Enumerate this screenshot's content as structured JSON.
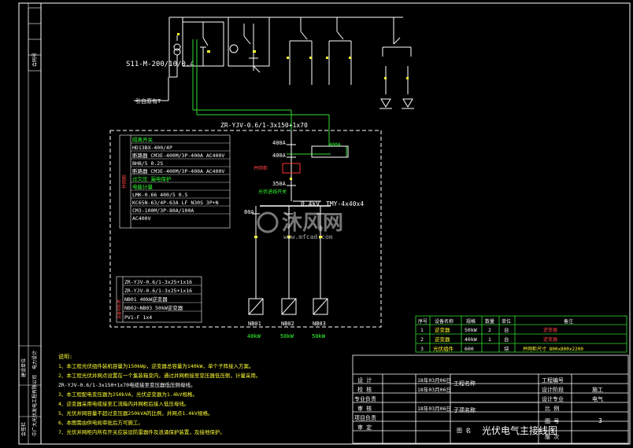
{
  "top": {
    "transformer_label": "S11-M-200/10/0.4",
    "incoming_label": "引自原有T"
  },
  "cable_top": "ZR-YJV-0.6/1-3x150+1x70",
  "breakers": {
    "b400a_1": "400A",
    "b400a_2": "400A",
    "b350a": "350A",
    "b80a": "80A",
    "b400a_note": "400A"
  },
  "box_label_1": "并网柜",
  "red_note": "并网柜",
  "switch_note": "光伏进线开关",
  "bus_label": "0.4kV",
  "bus_spec": "TMY-4x40x4",
  "legend_items": [
    "隔离开关",
    "HD13BX-400/4P",
    "断路器 CM3E-400M/3P-400A AC400V",
    "BHB/5 0.2S",
    "断路器 CM3E-400M/3P-400A AC400V",
    "过欠压 漏电保护",
    "电能计量",
    "LMK-0.66 400/5 0.5",
    "KC65N-63/4P-63A LF N30S 3P+N",
    "CM3-100M/3P-80A/100A",
    "AC400V"
  ],
  "side_label": "设备材料表",
  "cable_items": [
    "ZR-YJV-0.6/1-3x25+1x16",
    "ZR-YJV-0.6/1-3x25+1x16",
    "NB01 40kW逆变器",
    "NB02~NB03 50kW逆变器",
    "PV1-F 1x4"
  ],
  "inverters": [
    {
      "label": "NB01",
      "power": "40kW"
    },
    {
      "label": "NB02",
      "power": "50kW"
    },
    {
      "label": "NB03",
      "power": "50kW"
    }
  ],
  "notes": [
    "说明:",
    "1、本工程光伏组件装机容量为150kWp，逆变器总容量为140kW，单个子阵接入方案。",
    "2、本工程光伏并网点设置在一个集装箱变内，通过并网柜接至变压器低压侧，计量采用。",
    "ZR-YJV-0.6/1-3x150+1x70电缆接至变压器低压侧母线。",
    "3、本工程配电变压器为250kVA，光伏逆变器为1.4kV规格。",
    "4、逆变器采用电缆接至汇流箱内并网柜后接入低压母线。",
    "5、光伏并网容量不超过变压器250kVA的比例，并网点1.4kV规格。",
    "6、本图需由供电局审批后方可施工。",
    "7、光伏并网柜内所有开关应装设防雷器件及浪涌保护装置，及接地保护。"
  ],
  "table_header": [
    "序号",
    "设备名称",
    "规格",
    "数量",
    "单位",
    "备注"
  ],
  "table_rows": [
    [
      "1",
      "逆变器",
      "50kW",
      "2",
      "台",
      "逆变器"
    ],
    [
      "2",
      "逆变器",
      "40kW",
      "1",
      "台",
      "逆变器"
    ],
    [
      "3",
      "光伏组件",
      "600",
      "",
      "块",
      "并网柜尺寸 800x800x2200"
    ]
  ],
  "title_block": {
    "design": "设 计",
    "check": "校 核",
    "review": "专业负责",
    "audit": "审 核",
    "manager": "项目负责",
    "approve": "审 定",
    "date": "18年03月06日",
    "project_name_label": "工程名称",
    "subitem_label": "子项名称",
    "drawing_name_label": "图 名",
    "drawing_title": "光伏电气主接线图",
    "project_no_label": "工程编号",
    "stage_label": "设计阶段",
    "stage_value": "施工",
    "specialty_label": "设计专业",
    "specialty_value": "电气",
    "scale_label": "比 例",
    "drawing_no_label": "图 号",
    "drawing_no_value": "3",
    "version_label": "版 次"
  },
  "left_strip": [
    "会签栏",
    "中广大光伏发电工程有限公司",
    "建设单位",
    "电力设计",
    "合同号"
  ],
  "watermark_text": "沐风网",
  "watermark_url": "www.mfcad.com"
}
